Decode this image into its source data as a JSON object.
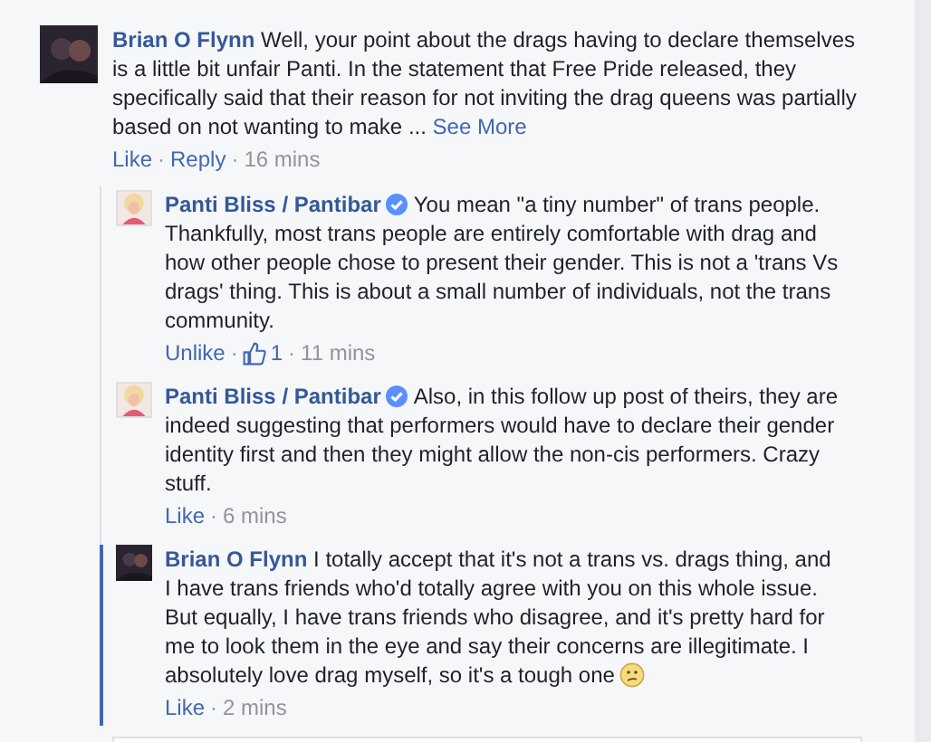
{
  "separator": "·",
  "comment": {
    "author": "Brian O Flynn",
    "verified": false,
    "avatar": {
      "kind": "photo"
    },
    "text": "Well, your point about the drags having to declare themselves is a little bit unfair Panti. In the statement that Free Pride released, they specifically said that their reason for not inviting the drag queens was partially based on not wanting to make ...",
    "see_more": "See More",
    "actions": [
      "Like",
      "Reply"
    ],
    "time": "16 mins",
    "replies": [
      {
        "author": "Panti Bliss / Pantibar",
        "verified": true,
        "avatar": {
          "kind": "drag"
        },
        "highlighted": false,
        "emoji": false,
        "text": "You mean \"a tiny number\" of trans people. Thankfully, most trans people are entirely comfortable with drag and how other people chose to present their gender. This is not a 'trans Vs drags' thing. This is about a small number of individuals, not the trans community.",
        "actions": [
          "Unlike"
        ],
        "like_count": "1",
        "time": "11 mins"
      },
      {
        "author": "Panti Bliss / Pantibar",
        "verified": true,
        "avatar": {
          "kind": "drag"
        },
        "highlighted": false,
        "emoji": false,
        "text": "Also, in this follow up post of theirs, they are indeed suggesting that performers would have to declare their gender identity first and then they might allow the non-cis performers. Crazy stuff.",
        "actions": [
          "Like"
        ],
        "time": "6 mins"
      },
      {
        "author": "Brian O Flynn",
        "verified": false,
        "avatar": {
          "kind": "photo"
        },
        "highlighted": true,
        "emoji": true,
        "text": "I totally accept that it's not a trans vs. drags thing, and I have trans friends who'd totally agree with you on this whole issue. But equally, I have trans friends who disagree, and it's pretty hard for me to look them in the eye and say their concerns are illegitimate. I absolutely love drag myself, so it's a tough one",
        "actions": [
          "Like"
        ],
        "time": "2 mins"
      }
    ]
  },
  "reply_field": {
    "visible": true
  }
}
